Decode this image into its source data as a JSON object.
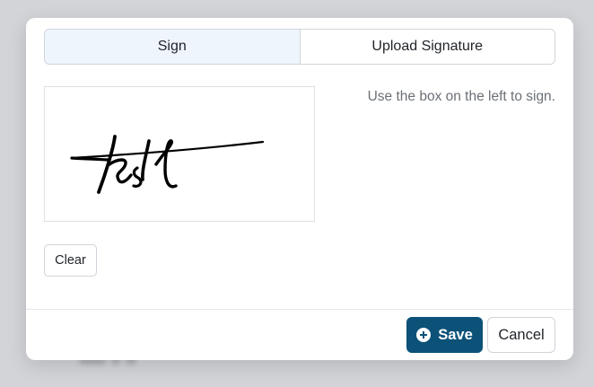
{
  "tabs": [
    {
      "label": "Sign",
      "active": true
    },
    {
      "label": "Upload Signature",
      "active": false
    }
  ],
  "signature_pad": {
    "drawn_text": "test",
    "hint": "Use the box on the left to sign."
  },
  "buttons": {
    "clear_label": "Clear",
    "save_label": "Save",
    "save_icon": "plus-circle-icon",
    "cancel_label": "Cancel"
  },
  "colors": {
    "primary": "#0c5178",
    "active_tab_bg": "#eef5fd",
    "overlay": "#d3d4d8"
  }
}
